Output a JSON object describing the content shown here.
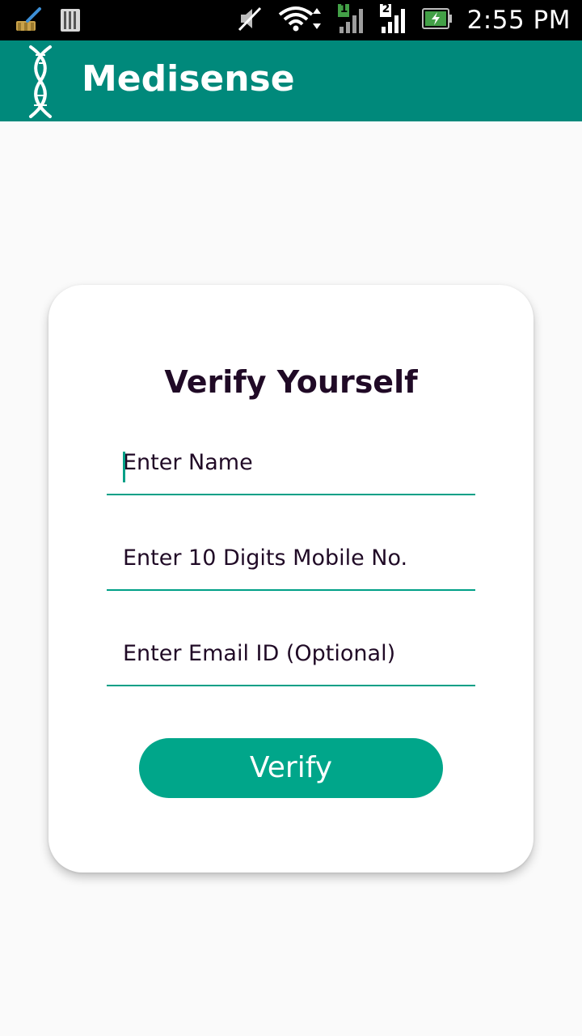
{
  "status_bar": {
    "time": "2:55 PM",
    "icons": [
      "cleaner-broom-icon",
      "sd-card-icon",
      "muted-icon",
      "wifi-icon",
      "signal-sim1-icon",
      "signal-sim2-icon",
      "battery-charging-icon"
    ],
    "sim1_label": "1",
    "sim2_label": "2"
  },
  "app_bar": {
    "title": "Medisense",
    "logo": "dna-icon",
    "color": "#00897b"
  },
  "form": {
    "title": "Verify Yourself",
    "name_placeholder": "Enter Name",
    "mobile_placeholder": "Enter 10 Digits Mobile No.",
    "email_placeholder": "Enter Email ID (Optional)",
    "submit_label": "Verify",
    "accent_color": "#00a68a"
  }
}
